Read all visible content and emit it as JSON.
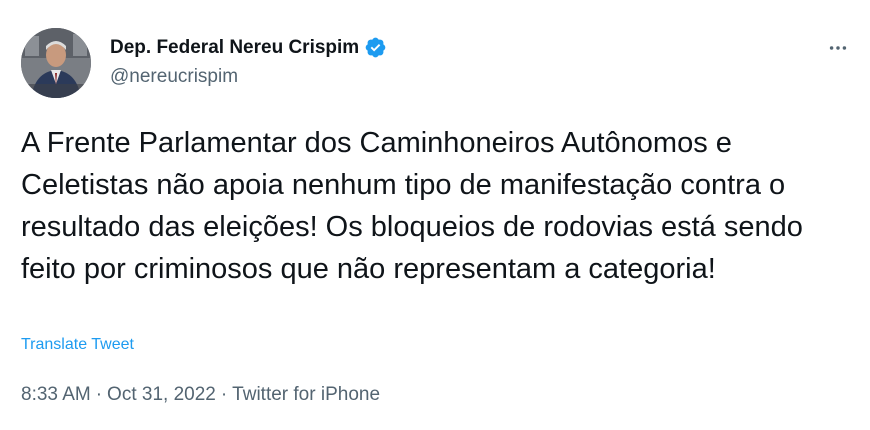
{
  "author": {
    "display_name": "Dep. Federal Nereu Crispim",
    "handle": "@nereucrispim",
    "verified_icon": "verified-badge-icon",
    "avatar_icon": "avatar-photo"
  },
  "tweet": {
    "text": "A Frente Parlamentar dos Caminhoneiros Autônomos e Celetistas não apoia nenhum tipo de manifestação contra o resultado das eleições! Os bloqueios de rodovias está sendo feito por criminosos que não representam a categoria!",
    "translate_label": "Translate Tweet"
  },
  "meta": {
    "time": "8:33 AM",
    "separator": "·",
    "date": "Oct 31, 2022",
    "source": "Twitter for iPhone"
  },
  "menu": {
    "more_icon": "more-horizontal-icon"
  },
  "colors": {
    "text_primary": "#0f1419",
    "text_secondary": "#536471",
    "link": "#1d9bf0",
    "verified": "#1d9bf0"
  }
}
